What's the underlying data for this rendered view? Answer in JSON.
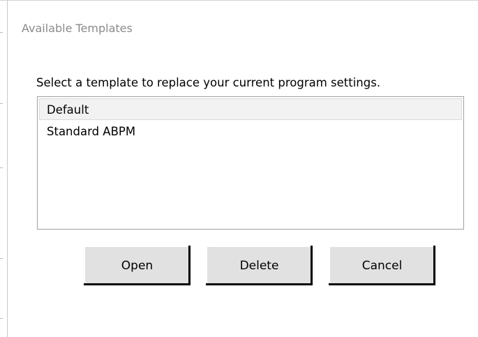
{
  "dialog": {
    "group_title": "Available Templates",
    "instruction": "Select a template to replace your current program settings.",
    "templates": [
      {
        "label": "Default",
        "selected": true
      },
      {
        "label": "Standard ABPM",
        "selected": false
      }
    ],
    "buttons": {
      "open": "Open",
      "delete": "Delete",
      "cancel": "Cancel"
    }
  },
  "colors": {
    "group_title_text": "#8a8a8a",
    "button_face": "#e1e1e1",
    "list_border": "#a0a0a0",
    "selected_row_bg": "#f2f2f2"
  }
}
